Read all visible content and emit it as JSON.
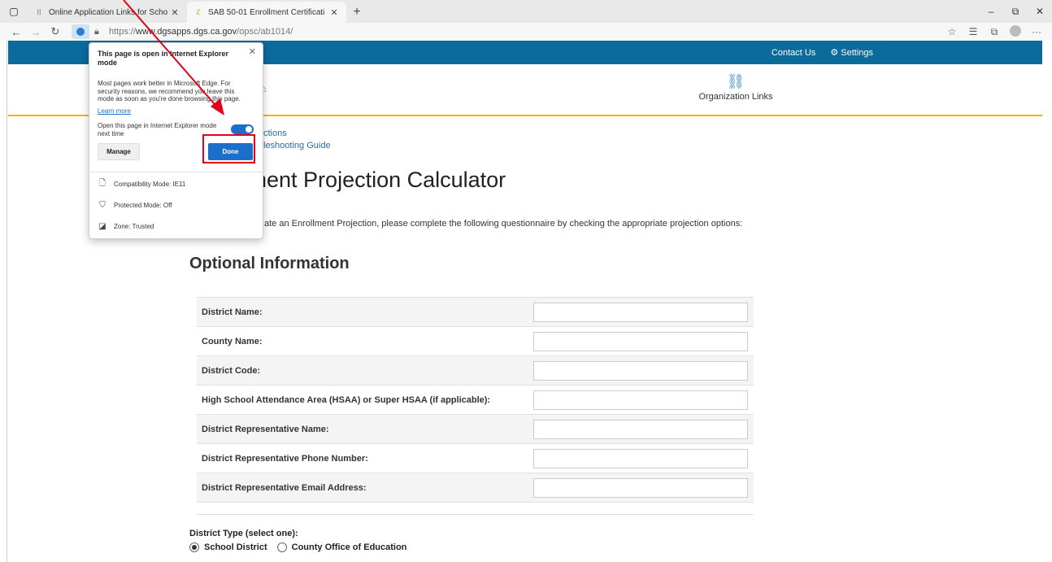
{
  "browser": {
    "tabs": [
      {
        "title": "Online Application Links for Scho",
        "active": false,
        "favicon": "⁞⁞"
      },
      {
        "title": "SAB 50-01 Enrollment Certificati",
        "active": true,
        "favicon": "ℰ"
      }
    ],
    "new_tab": "+",
    "window_controls": {
      "minimize": "–",
      "restore": "⧉",
      "close": "✕"
    },
    "url_scheme": "https://",
    "url_host": "www.dgsapps.dgs.ca.gov",
    "url_path": "/opsc/ab1014/",
    "icons": [
      "back-icon",
      "forward-icon",
      "refresh-icon",
      "ie-mode-icon",
      "lock-icon",
      "favorites-add-icon",
      "favorites-icon",
      "collections-icon",
      "profile-icon",
      "more-icon"
    ]
  },
  "site": {
    "header_color": "#0a6b9c",
    "accent_color": "#f5b400",
    "contact_us": "Contact Us",
    "settings": "Settings",
    "org_links": "Organization Links",
    "link_1": "ctions",
    "link_2": "leshooting Guide",
    "page_title": "nent Projection Calculator",
    "intro": "ate an Enrollment Projection, please complete the following questionnaire by checking the appropriate projection options:",
    "section_title": "Optional Information",
    "fields": [
      {
        "label": "District Name:",
        "value": ""
      },
      {
        "label": "County Name:",
        "value": ""
      },
      {
        "label": "District Code:",
        "value": ""
      },
      {
        "label": "High School Attendance Area (HSAA) or Super HSAA (if applicable):",
        "value": ""
      },
      {
        "label": "District Representative Name:",
        "value": ""
      },
      {
        "label": "District Representative Phone Number:",
        "value": ""
      },
      {
        "label": "District Representative Email Address:",
        "value": ""
      }
    ],
    "district_type_label": "District Type (select one):",
    "district_type_options": [
      {
        "label": "School District",
        "selected": true
      },
      {
        "label": "County Office of Education",
        "selected": false
      }
    ]
  },
  "ie_popup": {
    "title": "This page is open in Internet Explorer mode",
    "description": "Most pages work better in Microsoft Edge. For security reasons, we recommend you leave this mode as soon as you're done browsing this page.",
    "learn_more": "Learn more",
    "open_next_time": "Open this page in Internet Explorer mode next time",
    "toggle_on": true,
    "manage_label": "Manage",
    "done_label": "Done",
    "compat_mode": "Compatibility Mode: IE11",
    "protected_mode": "Protected Mode: Off",
    "zone": "Zone: Trusted",
    "highlight_color": "#e2001a"
  }
}
